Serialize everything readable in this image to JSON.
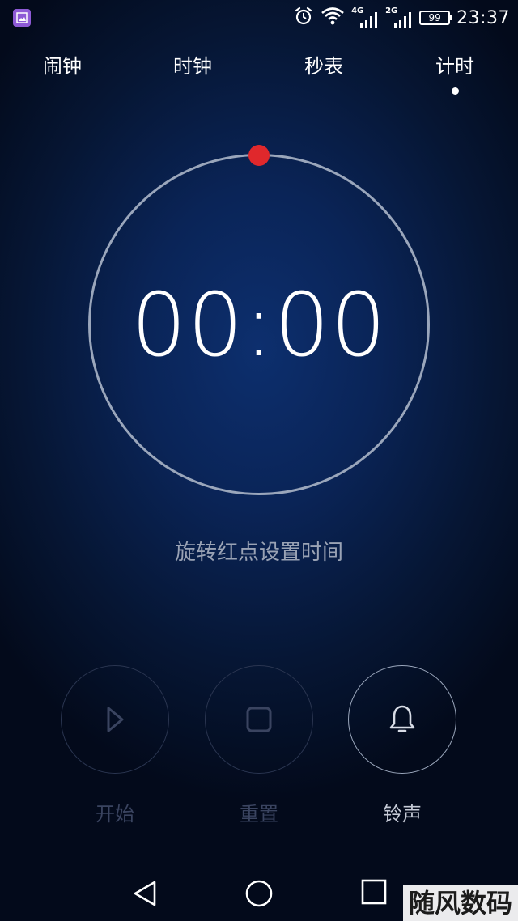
{
  "status_bar": {
    "network_1": "4G",
    "network_2": "2G",
    "battery": "99",
    "time": "23:37",
    "icons": [
      "gallery-icon",
      "alarm-clock-icon",
      "wifi-icon",
      "signal-icon",
      "signal-icon",
      "battery-icon"
    ]
  },
  "tabs": [
    {
      "label": "闹钟"
    },
    {
      "label": "时钟"
    },
    {
      "label": "秒表"
    },
    {
      "label": "计时"
    }
  ],
  "active_tab": "计时",
  "timer": {
    "display": "00:00",
    "hint": "旋转红点设置时间",
    "accent_color": "#e0282c"
  },
  "controls": {
    "start_label": "开始",
    "reset_label": "重置",
    "ringtone_label": "铃声"
  },
  "watermark": "随风数码网"
}
